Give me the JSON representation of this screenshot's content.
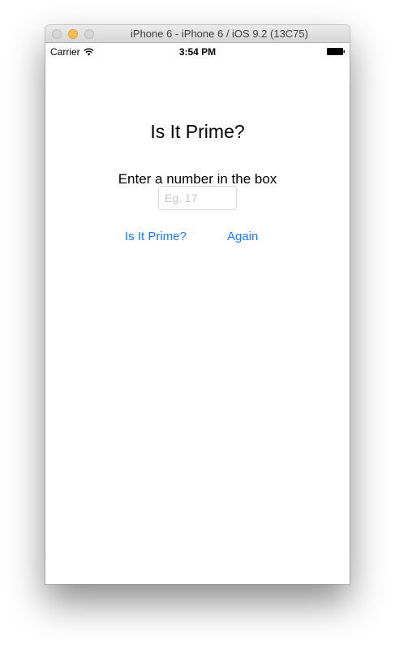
{
  "window": {
    "title": "iPhone 6 - iPhone 6 / iOS 9.2 (13C75)",
    "controls": [
      "close-icon",
      "minimize-icon",
      "zoom-icon"
    ]
  },
  "status_bar": {
    "carrier": "Carrier",
    "time": "3:54 PM",
    "icons": [
      "wifi-icon",
      "battery-icon"
    ]
  },
  "app": {
    "title": "Is It Prime?",
    "instruction": "Enter a number in the box",
    "number_input": {
      "value": "",
      "placeholder": "Eg. 17"
    },
    "buttons": {
      "check_label": "Is It Prime?",
      "again_label": "Again"
    }
  },
  "colors": {
    "button_tint": "#1a7cf5",
    "placeholder": "#c7c7cd",
    "minimize_button": "#f6be4f"
  }
}
